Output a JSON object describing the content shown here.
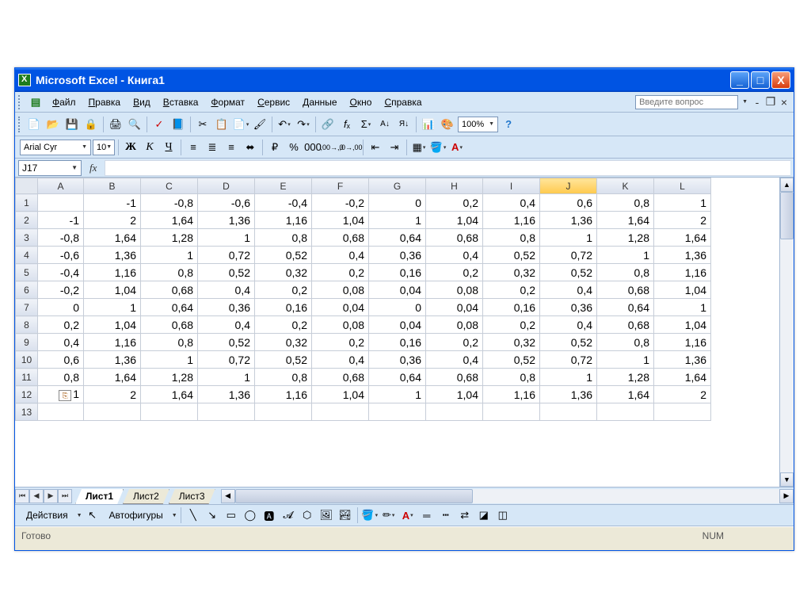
{
  "titlebar": {
    "title": "Microsoft Excel - Книга1"
  },
  "menubar": {
    "items": [
      "Файл",
      "Правка",
      "Вид",
      "Вставка",
      "Формат",
      "Сервис",
      "Данные",
      "Окно",
      "Справка"
    ],
    "help_placeholder": "Введите вопрос"
  },
  "toolbar": {
    "zoom": "100%"
  },
  "format": {
    "font_name": "Arial Cyr",
    "font_size": "10",
    "bold": "Ж",
    "italic": "К",
    "underline": "Ч"
  },
  "formula": {
    "namebox": "J17",
    "fx": "fx",
    "value": ""
  },
  "columns": [
    "A",
    "B",
    "C",
    "D",
    "E",
    "F",
    "G",
    "H",
    "I",
    "J",
    "K",
    "L"
  ],
  "selected_col": "J",
  "rows": [
    {
      "n": "1",
      "cells": [
        "",
        "-1",
        "-0,8",
        "-0,6",
        "-0,4",
        "-0,2",
        "0",
        "0,2",
        "0,4",
        "0,6",
        "0,8",
        "1"
      ]
    },
    {
      "n": "2",
      "cells": [
        "-1",
        "2",
        "1,64",
        "1,36",
        "1,16",
        "1,04",
        "1",
        "1,04",
        "1,16",
        "1,36",
        "1,64",
        "2"
      ]
    },
    {
      "n": "3",
      "cells": [
        "-0,8",
        "1,64",
        "1,28",
        "1",
        "0,8",
        "0,68",
        "0,64",
        "0,68",
        "0,8",
        "1",
        "1,28",
        "1,64"
      ]
    },
    {
      "n": "4",
      "cells": [
        "-0,6",
        "1,36",
        "1",
        "0,72",
        "0,52",
        "0,4",
        "0,36",
        "0,4",
        "0,52",
        "0,72",
        "1",
        "1,36"
      ]
    },
    {
      "n": "5",
      "cells": [
        "-0,4",
        "1,16",
        "0,8",
        "0,52",
        "0,32",
        "0,2",
        "0,16",
        "0,2",
        "0,32",
        "0,52",
        "0,8",
        "1,16"
      ]
    },
    {
      "n": "6",
      "cells": [
        "-0,2",
        "1,04",
        "0,68",
        "0,4",
        "0,2",
        "0,08",
        "0,04",
        "0,08",
        "0,2",
        "0,4",
        "0,68",
        "1,04"
      ]
    },
    {
      "n": "7",
      "cells": [
        "0",
        "1",
        "0,64",
        "0,36",
        "0,16",
        "0,04",
        "0",
        "0,04",
        "0,16",
        "0,36",
        "0,64",
        "1"
      ]
    },
    {
      "n": "8",
      "cells": [
        "0,2",
        "1,04",
        "0,68",
        "0,4",
        "0,2",
        "0,08",
        "0,04",
        "0,08",
        "0,2",
        "0,4",
        "0,68",
        "1,04"
      ]
    },
    {
      "n": "9",
      "cells": [
        "0,4",
        "1,16",
        "0,8",
        "0,52",
        "0,32",
        "0,2",
        "0,16",
        "0,2",
        "0,32",
        "0,52",
        "0,8",
        "1,16"
      ]
    },
    {
      "n": "10",
      "cells": [
        "0,6",
        "1,36",
        "1",
        "0,72",
        "0,52",
        "0,4",
        "0,36",
        "0,4",
        "0,52",
        "0,72",
        "1",
        "1,36"
      ]
    },
    {
      "n": "11",
      "cells": [
        "0,8",
        "1,64",
        "1,28",
        "1",
        "0,8",
        "0,68",
        "0,64",
        "0,68",
        "0,8",
        "1",
        "1,28",
        "1,64"
      ]
    },
    {
      "n": "12",
      "cells": [
        "1",
        "2",
        "1,64",
        "1,36",
        "1,16",
        "1,04",
        "1",
        "1,04",
        "1,16",
        "1,36",
        "1,64",
        "2"
      ],
      "smart_tag": true
    },
    {
      "n": "13",
      "cells": [
        "",
        "",
        "",
        "",
        "",
        "",
        "",
        "",
        "",
        "",
        "",
        ""
      ]
    }
  ],
  "tabs": {
    "items": [
      "Лист1",
      "Лист2",
      "Лист3"
    ],
    "active": 0
  },
  "drawbar": {
    "actions": "Действия",
    "autoshapes": "Автофигуры"
  },
  "statusbar": {
    "ready": "Готово",
    "num": "NUM"
  }
}
